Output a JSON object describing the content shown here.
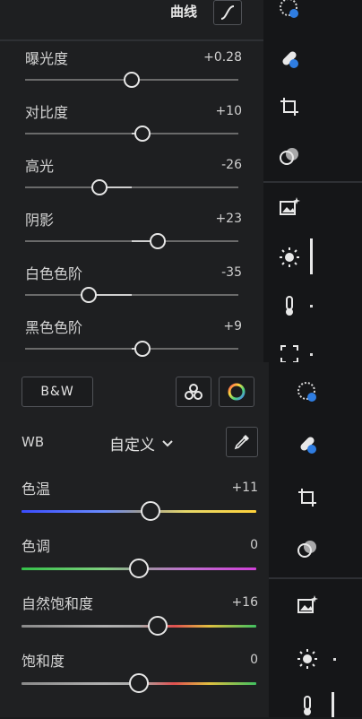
{
  "curve": {
    "label": "曲线"
  },
  "top_sliders": [
    {
      "label": "曝光度",
      "value": "+0.28",
      "pos": 0.5
    },
    {
      "label": "对比度",
      "value": "+10",
      "pos": 0.55
    },
    {
      "label": "高光",
      "value": "-26",
      "pos": 0.35
    },
    {
      "label": "阴影",
      "value": "+23",
      "pos": 0.62
    },
    {
      "label": "白色色阶",
      "value": "-35",
      "pos": 0.3
    },
    {
      "label": "黑色色阶",
      "value": "+9",
      "pos": 0.55
    }
  ],
  "bw_label": "B&W",
  "wb": {
    "label": "WB",
    "preset": "自定义"
  },
  "bottom_sliders": [
    {
      "label": "色温",
      "value": "+11",
      "pos": 0.55,
      "gradient": "temp"
    },
    {
      "label": "色调",
      "value": "0",
      "pos": 0.5,
      "gradient": "tint"
    },
    {
      "label": "自然饱和度",
      "value": "+16",
      "pos": 0.58,
      "gradient": "rainbow"
    },
    {
      "label": "饱和度",
      "value": "0",
      "pos": 0.5,
      "gradient": "rainbow"
    }
  ],
  "colors": {
    "accent": "#2f7de1",
    "knob": "#e6e6e6"
  }
}
